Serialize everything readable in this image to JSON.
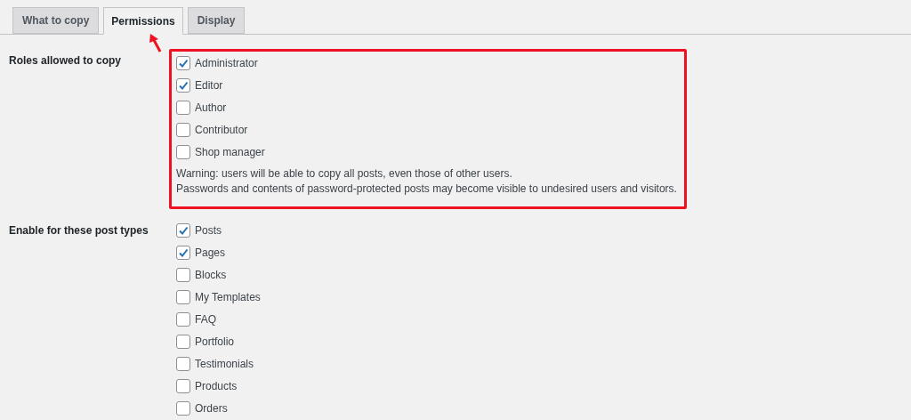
{
  "tabs": [
    {
      "label": "What to copy",
      "selected": false
    },
    {
      "label": "Permissions",
      "selected": true
    },
    {
      "label": "Display",
      "selected": false
    }
  ],
  "sections": [
    {
      "label": "Roles allowed to copy",
      "highlighted": true,
      "options": [
        {
          "label": "Administrator",
          "checked": true
        },
        {
          "label": "Editor",
          "checked": true
        },
        {
          "label": "Author",
          "checked": false
        },
        {
          "label": "Contributor",
          "checked": false
        },
        {
          "label": "Shop manager",
          "checked": false
        }
      ],
      "notes": [
        "Warning: users will be able to copy all posts, even those of other users.",
        "Passwords and contents of password-protected posts may become visible to undesired users and visitors."
      ]
    },
    {
      "label": "Enable for these post types",
      "highlighted": false,
      "options": [
        {
          "label": "Posts",
          "checked": true
        },
        {
          "label": "Pages",
          "checked": true
        },
        {
          "label": "Blocks",
          "checked": false
        },
        {
          "label": "My Templates",
          "checked": false
        },
        {
          "label": "FAQ",
          "checked": false
        },
        {
          "label": "Portfolio",
          "checked": false
        },
        {
          "label": "Testimonials",
          "checked": false
        },
        {
          "label": "Products",
          "checked": false
        },
        {
          "label": "Orders",
          "checked": false
        }
      ]
    }
  ]
}
